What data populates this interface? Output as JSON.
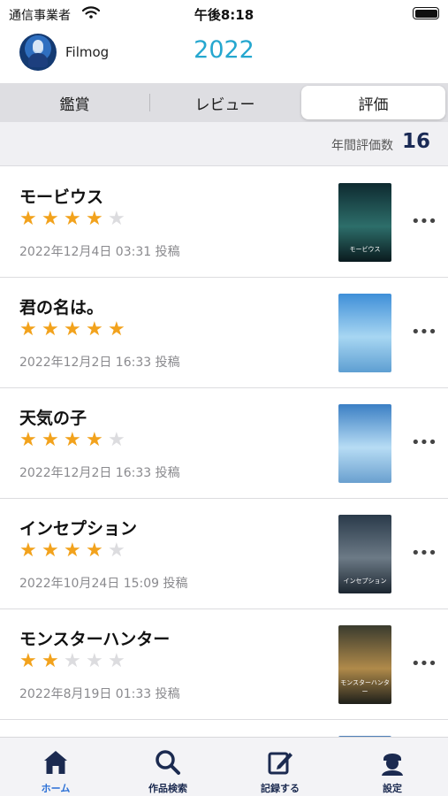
{
  "status_bar": {
    "carrier": "通信事業者",
    "time": "午後8:18"
  },
  "header": {
    "username": "Filmog",
    "year": "2022"
  },
  "segments": [
    "鑑賞",
    "レビュー",
    "評価"
  ],
  "active_segment": "評価",
  "summary": {
    "label": "年間評価数",
    "count": "16"
  },
  "colors": {
    "accent": "#25a7cf",
    "star": "#f2a21c",
    "tab_active": "#2a6fd6",
    "tab_inactive": "#1b2a50"
  },
  "ratings": [
    {
      "title": "モービウス",
      "stars": 4,
      "date": "2022年12月4日 03:31 投稿",
      "poster_caption": "モービウス",
      "poster_colors": [
        "#0e2a30",
        "#2d6e6a",
        "#0a1a1e"
      ]
    },
    {
      "title": "君の名は。",
      "stars": 5,
      "date": "2022年12月2日 16:33 投稿",
      "poster_caption": "",
      "poster_colors": [
        "#3f8fd8",
        "#a7d6f2",
        "#5e9fd2"
      ]
    },
    {
      "title": "天気の子",
      "stars": 4,
      "date": "2022年12月2日 16:33 投稿",
      "poster_caption": "",
      "poster_colors": [
        "#3b7fc4",
        "#b7dcf4",
        "#6aa0cf"
      ]
    },
    {
      "title": "インセプション",
      "stars": 4,
      "date": "2022年10月24日 15:09 投稿",
      "poster_caption": "インセプション",
      "poster_colors": [
        "#2a3a4a",
        "#6c7a86",
        "#1c2630"
      ]
    },
    {
      "title": "モンスターハンター",
      "stars": 2,
      "date": "2022年8月19日 01:33 投稿",
      "poster_caption": "モンスターハンター",
      "poster_colors": [
        "#3a3b2e",
        "#b08a4a",
        "#1e1f1a"
      ]
    }
  ],
  "partial_row_poster_colors": [
    "#4e7fb8",
    "#9fc2e0",
    "#2c4f7a"
  ],
  "more_icon": "ellipsis-icon",
  "tabs": [
    {
      "label": "ホーム",
      "icon": "home-icon"
    },
    {
      "label": "作品検索",
      "icon": "search-icon"
    },
    {
      "label": "記録する",
      "icon": "edit-icon"
    },
    {
      "label": "設定",
      "icon": "person-icon"
    }
  ],
  "active_tab": "ホーム"
}
